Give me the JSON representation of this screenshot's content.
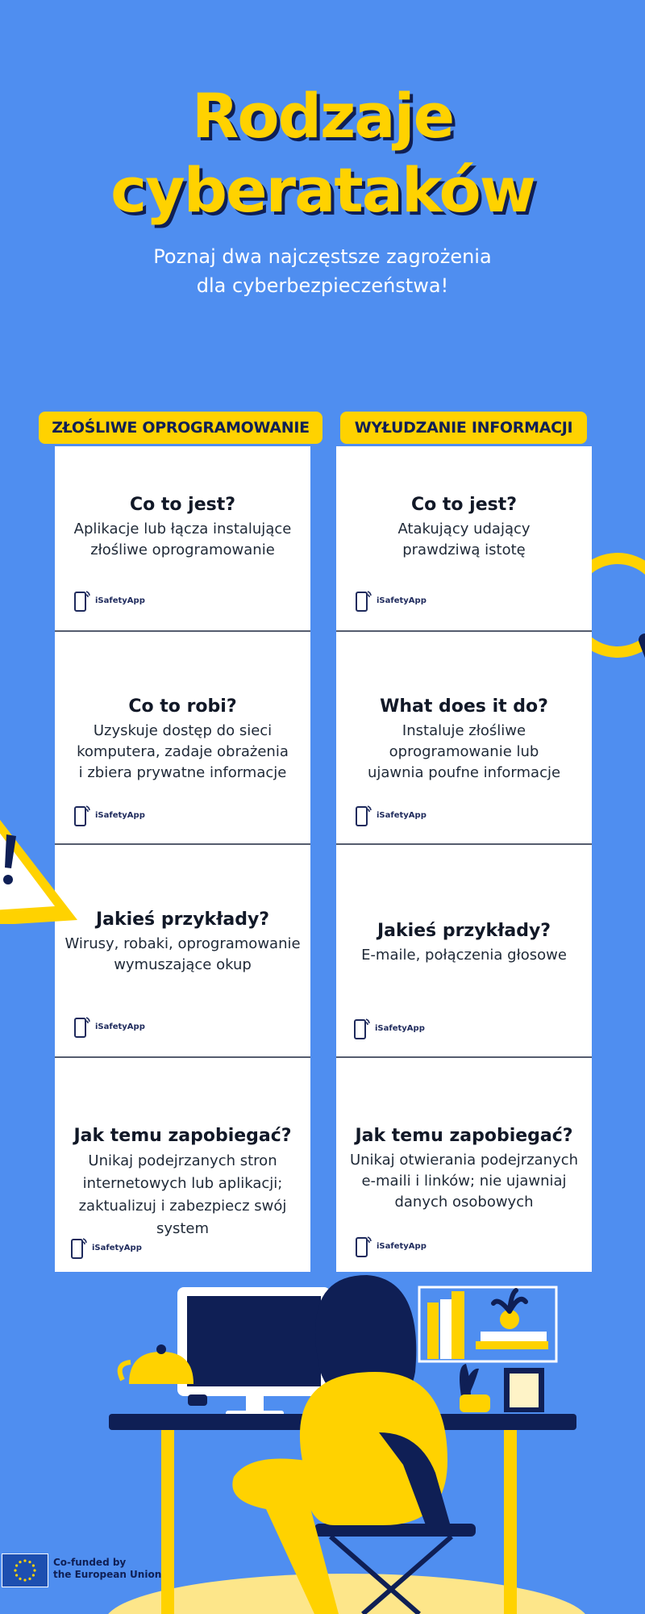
{
  "header": {
    "title_line1": "Rodzaje",
    "title_line2": "cyberataków",
    "subtitle_line1": "Poznaj dwa najczęstsze zagrożenia",
    "subtitle_line2": "dla cyberbezpieczeństwa!"
  },
  "columns": [
    {
      "heading": "ZŁOŚLIWE OPROGRAMOWANIE",
      "cards": [
        {
          "question": "Co to jest?",
          "answer_lines": [
            "Aplikacje lub łącza instalujące",
            "złośliwe oprogramowanie"
          ]
        },
        {
          "question": "Co to robi?",
          "answer_lines": [
            "Uzyskuje dostęp do sieci",
            "komputera, zadaje obrażenia",
            "i zbiera prywatne informacje"
          ]
        },
        {
          "question": "Jakieś przykłady?",
          "answer_lines": [
            "Wirusy, robaki, oprogramowanie",
            "wymuszające okup"
          ]
        },
        {
          "question": "Jak temu zapobiegać?",
          "answer_lines": [
            "Unikaj podejrzanych stron",
            "internetowych lub aplikacji;",
            "zaktualizuj i zabezpiecz swój",
            "system"
          ]
        }
      ]
    },
    {
      "heading": "WYŁUDZANIE INFORMACJI",
      "cards": [
        {
          "question": "Co to jest?",
          "answer_lines": [
            "Atakujący udający",
            "prawdziwą istotę"
          ]
        },
        {
          "question": "What does it do?",
          "answer_lines": [
            "Instaluje złośliwe",
            "oprogramowanie lub",
            "ujawnia poufne informacje"
          ]
        },
        {
          "question": "Jakieś przykłady?",
          "answer_lines": [
            "E-maile, połączenia głosowe"
          ]
        },
        {
          "question": "Jak temu zapobiegać?",
          "answer_lines": [
            "Unikaj otwierania podejrzanych",
            "e-maili i linków; nie ujawniaj",
            "danych osobowych"
          ]
        }
      ]
    }
  ],
  "brand": {
    "name": "iSafetyApp",
    "icon": "phone-signal-icon"
  },
  "footer": {
    "line1": "Co-funded by",
    "line2": "the European Union",
    "icon": "eu-flag-icon"
  },
  "colors": {
    "background": "#4f8ef0",
    "accent": "#ffd200",
    "navy": "#0f1f55",
    "card": "#ffffff"
  },
  "decorations": [
    "magnifier-icon",
    "warning-triangle-icon",
    "woman-at-desk-illustration"
  ]
}
